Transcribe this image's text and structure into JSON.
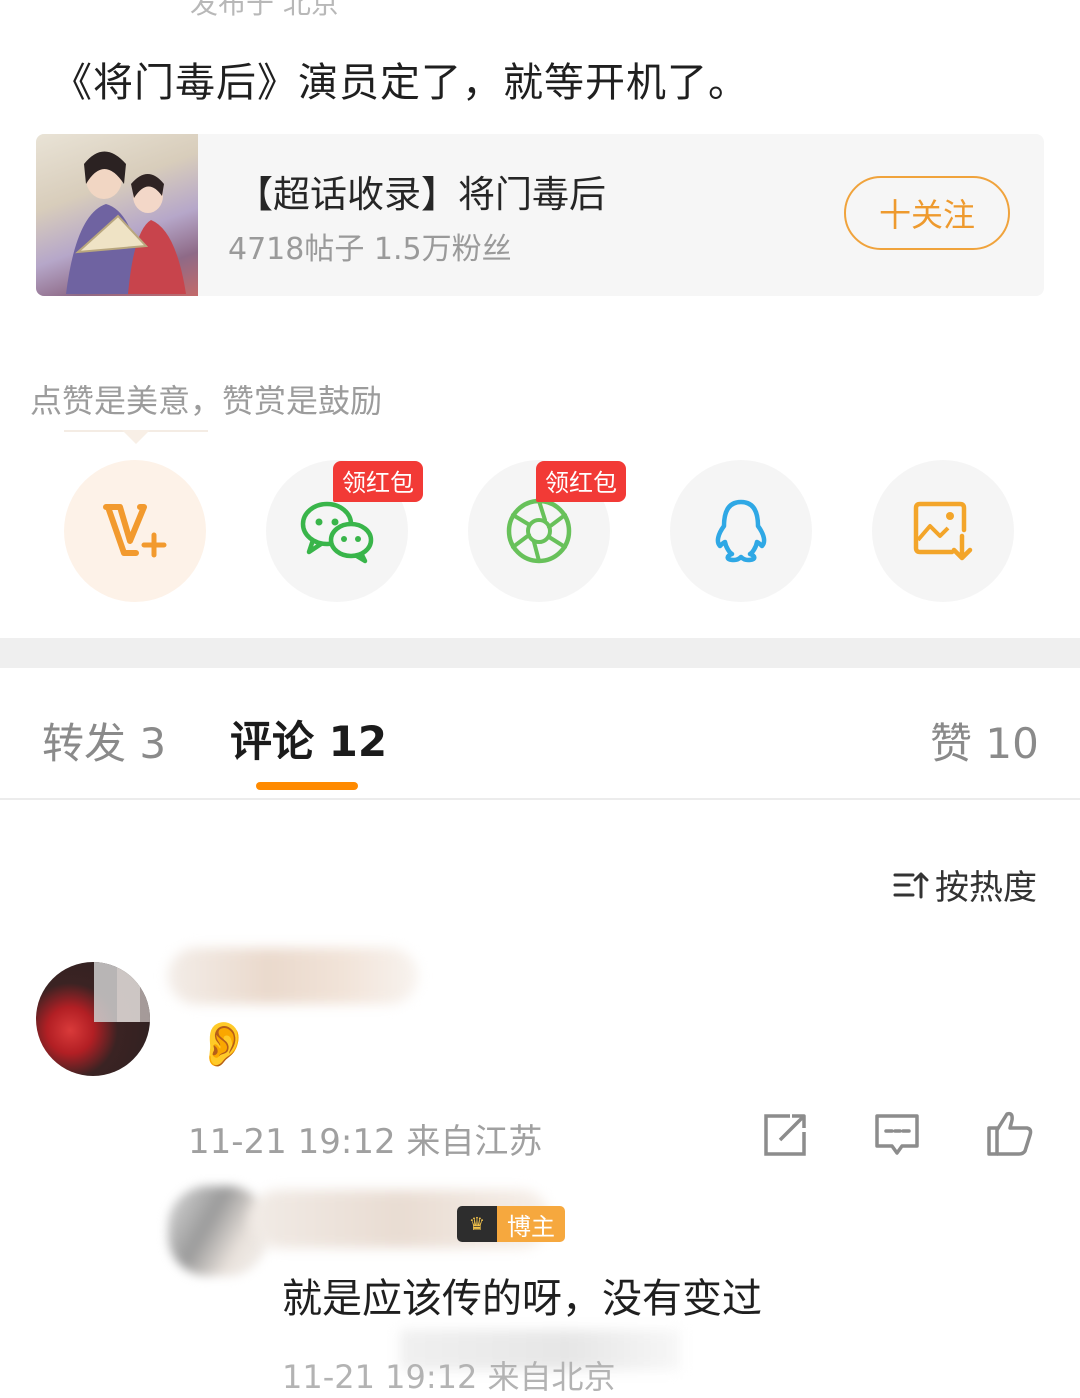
{
  "post": {
    "top_meta": "发布于 北京",
    "text": "《将门毒后》演员定了，就等开机了。"
  },
  "topic_card": {
    "title": "【超话收录】将门毒后",
    "stats": "4718帖子 1.5万粉丝",
    "follow_label": "十关注",
    "accent": "#f0a33c"
  },
  "praise": {
    "hint": "点赞是美意，赞赏是鼓励"
  },
  "share": {
    "items": [
      {
        "name": "v-plus",
        "badge": ""
      },
      {
        "name": "wechat",
        "badge": "领红包"
      },
      {
        "name": "moments",
        "badge": "领红包"
      },
      {
        "name": "qq",
        "badge": ""
      },
      {
        "name": "save-image",
        "badge": ""
      }
    ]
  },
  "tabs": {
    "repost": "转发 3",
    "comment": "评论 12",
    "like": "赞 10",
    "indicator_color": "#ff8a00"
  },
  "sort": {
    "label": "按热度"
  },
  "comment1": {
    "emoji": "👂",
    "meta": "11-21 19:12 来自江苏"
  },
  "reply": {
    "badge": "博主",
    "text": "就是应该传的呀，没有变过",
    "meta": "11-21 19:12 来自北京"
  }
}
